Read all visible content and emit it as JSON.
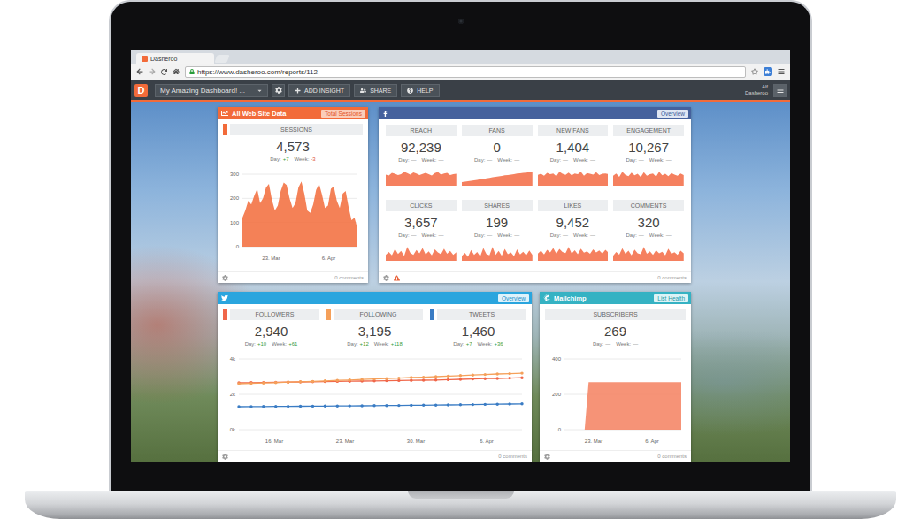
{
  "browser": {
    "tab": "Dasheroo",
    "url": "https://www.dasheroo.com/reports/112"
  },
  "toolbar": {
    "logo": "D",
    "dashboard": "My Amazing Dashboard! ...",
    "buttons": [
      {
        "label": "ADD INSIGHT",
        "kind": "add"
      },
      {
        "label": "SHARE",
        "kind": "share"
      },
      {
        "label": "HELP",
        "kind": "help"
      }
    ],
    "user": [
      "Alf",
      "Dasheroo"
    ]
  },
  "stat_labels": {
    "day": "Day:",
    "week": "Week:"
  },
  "web": {
    "title": "All Web Site Data",
    "badge": "Total Sessions",
    "metric": {
      "label": "SESSIONS",
      "value": "4,573",
      "day": "+7",
      "week": "-3",
      "color": "#f26b3a"
    },
    "chart": {
      "y_ticks": [
        "300",
        "200",
        "100",
        "0"
      ],
      "x_labels": [
        "23. Mar",
        "6. Apr"
      ],
      "values": [
        120,
        150,
        190,
        175,
        210,
        240,
        180,
        200,
        245,
        260,
        195,
        150,
        170,
        230,
        265,
        255,
        200,
        160,
        180,
        245,
        270,
        220,
        150,
        140,
        175,
        235,
        260,
        215,
        160,
        170,
        240,
        250,
        190,
        160,
        220,
        230,
        165,
        110,
        120,
        75
      ]
    },
    "comments": "0 comments"
  },
  "facebook": {
    "badge": "Overview",
    "warning": true,
    "comments": "0 comments",
    "metrics": [
      {
        "label": "REACH",
        "value": "92,239",
        "day": "—",
        "week": "—",
        "spark": [
          60,
          55,
          70,
          65,
          58,
          62,
          75,
          68,
          60,
          72,
          66,
          58,
          64,
          70,
          62,
          55,
          68,
          74,
          60,
          66,
          70,
          58,
          62,
          65
        ]
      },
      {
        "label": "FANS",
        "value": "0",
        "day": "—",
        "week": "—",
        "spark": [
          20,
          22,
          25,
          28,
          30,
          33,
          36,
          38,
          41,
          44,
          47,
          50,
          52,
          55,
          58,
          60,
          62,
          65,
          68,
          70,
          72,
          74,
          76,
          78
        ]
      },
      {
        "label": "NEW FANS",
        "value": "1,404",
        "day": "—",
        "week": "—",
        "spark": [
          55,
          60,
          50,
          65,
          58,
          62,
          48,
          70,
          60,
          55,
          66,
          52,
          62,
          58,
          70,
          50,
          64,
          60,
          56,
          68,
          54,
          60,
          62,
          58
        ]
      },
      {
        "label": "ENGAGEMENT",
        "value": "10,267",
        "day": "—",
        "week": "—",
        "spark": [
          50,
          62,
          45,
          70,
          55,
          48,
          66,
          52,
          60,
          44,
          68,
          50,
          58,
          62,
          46,
          70,
          52,
          60,
          48,
          64,
          56,
          50,
          62,
          54
        ]
      },
      {
        "label": "CLICKS",
        "value": "3,657",
        "day": "—",
        "week": "—",
        "spark": [
          30,
          45,
          28,
          60,
          35,
          50,
          25,
          70,
          40,
          30,
          55,
          38,
          65,
          32,
          48,
          28,
          58,
          42,
          34,
          62,
          36,
          50,
          30,
          44
        ]
      },
      {
        "label": "SHARES",
        "value": "199",
        "day": "—",
        "week": "—",
        "spark": [
          25,
          40,
          20,
          55,
          30,
          45,
          22,
          65,
          35,
          28,
          70,
          30,
          50,
          26,
          60,
          34,
          42,
          24,
          58,
          32,
          46,
          28,
          52,
          30
        ]
      },
      {
        "label": "LIKES",
        "value": "9,452",
        "day": "—",
        "week": "—",
        "spark": [
          40,
          55,
          35,
          60,
          45,
          70,
          38,
          65,
          48,
          42,
          75,
          40,
          58,
          36,
          66,
          44,
          52,
          38,
          62,
          46,
          56,
          40,
          60,
          44
        ]
      },
      {
        "label": "COMMENTS",
        "value": "320",
        "day": "—",
        "week": "—",
        "spark": [
          20,
          35,
          25,
          50,
          28,
          40,
          22,
          45,
          30,
          26,
          55,
          28,
          38,
          24,
          42,
          30,
          36,
          22,
          48,
          28,
          34,
          24,
          40,
          30
        ]
      }
    ]
  },
  "twitter": {
    "badge": "Overview",
    "comments": "0 comments",
    "chart": {
      "y_ticks": [
        "4k",
        "2k",
        "0k"
      ],
      "x_labels": [
        "16. Mar",
        "23. Mar",
        "30. Mar",
        "6. Apr"
      ]
    },
    "metrics": [
      {
        "label": "FOLLOWERS",
        "value": "2,940",
        "day": "+10",
        "week": "+61",
        "color": "#f0674a",
        "values": [
          2650,
          2660,
          2670,
          2680,
          2690,
          2700,
          2710,
          2720,
          2730,
          2740,
          2750,
          2760,
          2770,
          2780,
          2790,
          2800,
          2810,
          2830,
          2850,
          2870,
          2890,
          2900,
          2920,
          2940
        ]
      },
      {
        "label": "FOLLOWING",
        "value": "3,195",
        "day": "+12",
        "week": "+118",
        "color": "#f5a05a",
        "values": [
          2600,
          2620,
          2640,
          2660,
          2690,
          2710,
          2730,
          2760,
          2790,
          2810,
          2840,
          2870,
          2890,
          2920,
          2950,
          2970,
          3000,
          3030,
          3060,
          3090,
          3120,
          3150,
          3170,
          3195
        ]
      },
      {
        "label": "TWEETS",
        "value": "1,460",
        "day": "+7",
        "week": "+36",
        "color": "#3a7cc4",
        "values": [
          1300,
          1305,
          1310,
          1315,
          1320,
          1325,
          1330,
          1335,
          1340,
          1345,
          1350,
          1360,
          1365,
          1370,
          1380,
          1385,
          1390,
          1400,
          1410,
          1420,
          1430,
          1440,
          1450,
          1460
        ]
      }
    ]
  },
  "mailchimp": {
    "title": "Mailchimp",
    "badge": "List Health",
    "metric": {
      "label": "SUBSCRIBERS",
      "value": "269",
      "day": "—",
      "week": "—"
    },
    "chart": {
      "y_ticks": [
        "400",
        "200",
        "0"
      ],
      "x_labels": [
        "23. Mar",
        "6. Apr"
      ],
      "values": [
        0,
        0,
        0,
        0,
        0,
        0,
        269,
        269,
        269,
        269,
        269,
        269,
        269,
        269,
        269,
        269,
        269,
        269,
        269,
        269,
        269,
        269,
        269,
        269,
        269,
        269,
        269,
        269,
        269,
        269
      ]
    },
    "comments": "0 comments"
  }
}
